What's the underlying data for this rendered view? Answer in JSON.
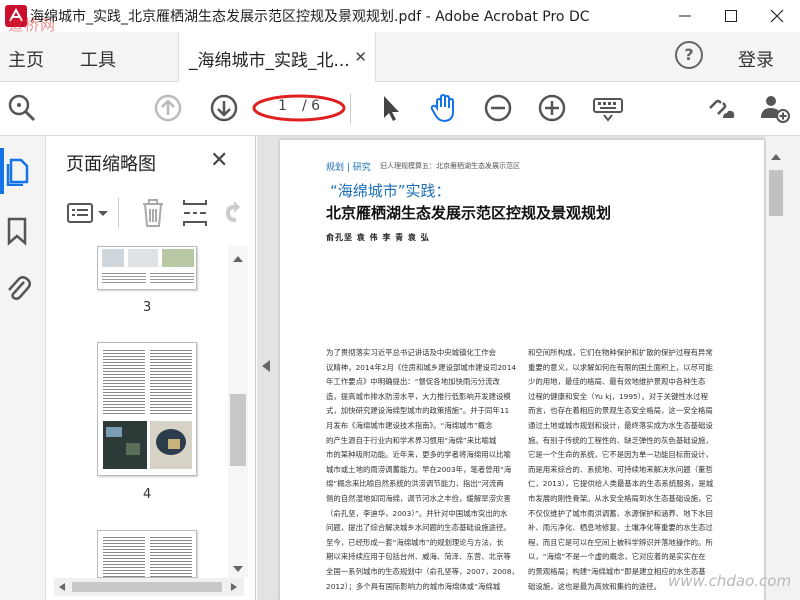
{
  "window": {
    "title": "海绵城市_实践_北京雁栖湖生态发展示范区控规及景观规划.pdf - Adobe Acrobat Pro DC",
    "logo_watermark": "道桥网"
  },
  "tabs": {
    "home": "主页",
    "tools": "工具",
    "document": "_海绵城市_实践_北...",
    "login": "登录"
  },
  "toolbar": {
    "page_current": "1",
    "page_total": "/ 6",
    "annotation_color": "#e02020"
  },
  "thumbnail_panel": {
    "title": "页面缩略图",
    "pages": [
      {
        "number": "3"
      },
      {
        "number": "4"
      }
    ]
  },
  "document": {
    "header_tags": "规划 | 研究",
    "header_sub": "旧人理规模算五：北京雁栖湖生态发展示范区",
    "title_line1": "“海绵城市”实践：",
    "title_line2": "北京雁栖湖生态发展示范区控规及景观规划",
    "authors": "俞孔坚  袁  伟  李  青  袁  弘",
    "left_column": [
      "为了贯彻落实习近平总书记讲话及中央城镇化工作会",
      "议精神，2014年2月《住房和城乡建设部城市建设司2014",
      "年工作要点》中明确提出：“督促各地加快雨污分流改",
      "造，提高城市排水防涝水平，大力推行低影响开发建设模",
      "式，加快研究建设海绵型城市的政策措施”。并于同年11",
      "月发布《海绵城市建设技术指南》。“海绵城市”概念",
      "的产生源自于行业内和学术界习惯用“海绵”来比喻城",
      "市的某种吸附功能。近年来，更多的学者将海绵用以比喻",
      "城市或土地的雨涝调蓄能力。早在2003年，笔者曾用“海",
      "绵”概念来比喻自然系统的洪涝调节能力，指出“河流两",
      "侧的自然湿地如同海绵，调节河水之丰俭，缓解旱涝灾害",
      "（俞孔坚，李迪华，2003）”。并针对中国城市突出的水",
      "问题，提出了综合解决城乡水问题的生态基础设施途径。",
      "至今，已经形成一套“海绵城市”的规划理论与方法，长",
      "期以来持续应用于包括台州、威海、菏泽、东营、北京等",
      "全国一系列城市的生态规划中（俞孔坚等，2007，2008，",
      "2012）；多个具有国际影响力的城市海绵体或“海绵城"
    ],
    "right_column": [
      "和空间所构成，它们在物种保护和扩散的保护过程有异常",
      "重要的意义，以求解如何在有限的国土面积上，以尽可能",
      "少的用地，最佳的格局、最有效地维护景观中各种生态",
      "过程的健康和安全（Yu kj，1995）。对于关键性水过程",
      "而言，也存在着相应的景观生态安全格局，这一安全格局",
      "通过土地或城市规划和设计，最终落实成为水生态基础设",
      "施。有别于传统的工程性的、缺乏弹性的灰色基础设施，",
      "它是一个生命的系统，它不是因为单一功能目标而设计，",
      "而是用来综合的、系统地、可持续地来解决水问题（董哲",
      "仁，2013），它提供给人类最基本的生态系统服务，是城",
      "市发展的刚性骨架。从水安全格局到水生态基础设施，它",
      "不仅仅维护了城市雨洪调蓄、水源保护和涵养、地下水回",
      "补、雨污净化、栖息地修复、土壤净化等重要的水生态过",
      "程，而且它是可以在空间上被科学辨识并落地操作的。所",
      "以，“海绵”不是一个虚的概念，它对应着的是实实在在",
      "的景观格局；构建“海绵城市”即是建立相应的水生态基",
      "础设施，这也是最为高效和集约的途径。"
    ]
  },
  "site_watermark": "www.chdao.com"
}
